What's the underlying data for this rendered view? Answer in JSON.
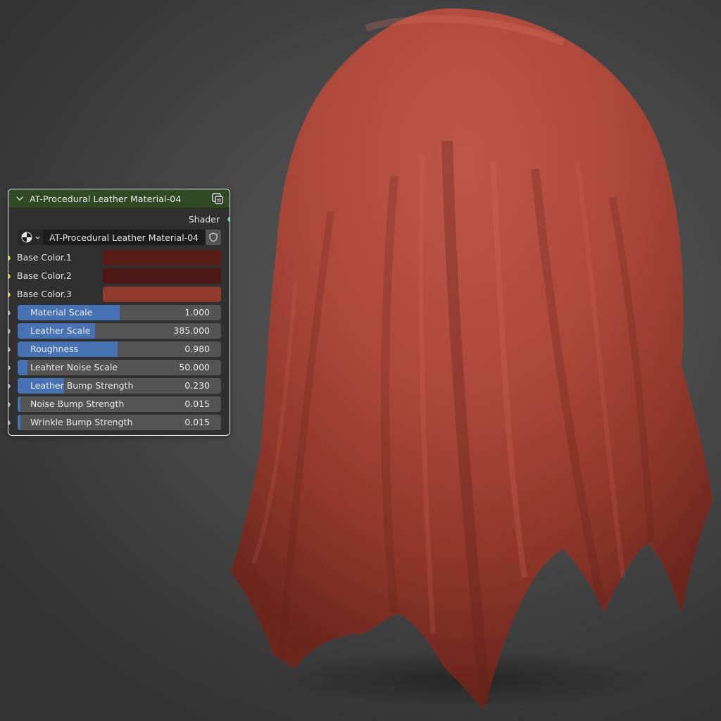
{
  "node": {
    "title": "AT-Procedural Leather Material-04",
    "output_label": "Shader",
    "material_name": "AT-Procedural Leather Material-04",
    "icons": {
      "collapse": "chevron-down-icon",
      "group": "node-group-icon",
      "material_type": "material-sphere-icon",
      "fake_user": "shield-icon"
    },
    "color_inputs": [
      {
        "label": "Base Color.1",
        "color": "#5a1c16"
      },
      {
        "label": "Base Color.2",
        "color": "#4d1813"
      },
      {
        "label": "Base Color.3",
        "color": "#8f3a2d"
      }
    ],
    "value_inputs": [
      {
        "label": "Material Scale",
        "value": "1.000",
        "fill": 0.5
      },
      {
        "label": "Leather Scale",
        "value": "385.000",
        "fill": 0.38
      },
      {
        "label": "Roughness",
        "value": "0.980",
        "fill": 0.49
      },
      {
        "label": "Leahter Noise Scale",
        "value": "50.000",
        "fill": 0.05
      },
      {
        "label": "Leather Bump Strength",
        "value": "0.230",
        "fill": 0.23
      },
      {
        "label": "Noise Bump Strength",
        "value": "0.015",
        "fill": 0.015
      },
      {
        "label": "Wrinkle Bump Strength",
        "value": "0.015",
        "fill": 0.015
      }
    ]
  },
  "colors": {
    "header": "#2f4a25",
    "slider_fill": "#4772b3",
    "slider_bg": "#545454",
    "shader_socket": "#5fd07a",
    "color_socket": "#c8c840",
    "value_socket": "#a1a1a1",
    "leather": "#b04a3c"
  }
}
